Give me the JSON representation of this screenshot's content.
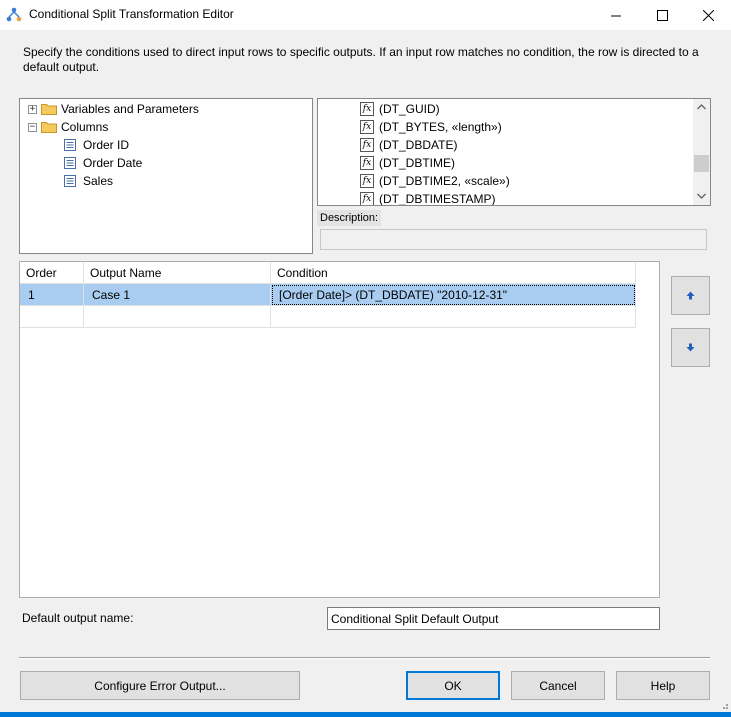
{
  "window": {
    "title": "Conditional Split Transformation Editor",
    "minimize_glyph": "—",
    "maximize_glyph": "☐",
    "close_glyph": "✕"
  },
  "instructions": "Specify the conditions used to direct input rows to specific outputs. If an input row matches no condition, the row is directed to a default output.",
  "tree": {
    "variables_label": "Variables and Parameters",
    "variables_expander": "+",
    "columns_label": "Columns",
    "columns_expander": "−",
    "columns": [
      "Order ID",
      "Order Date",
      "Sales"
    ]
  },
  "functions": {
    "icon_text": "fx",
    "items": [
      "(DT_GUID)",
      "(DT_BYTES, «length»)",
      "(DT_DBDATE)",
      "(DT_DBTIME)",
      "(DT_DBTIME2, «scale»)",
      "(DT_DBTIMESTAMP)"
    ]
  },
  "description": {
    "label": "Description:",
    "value": ""
  },
  "grid": {
    "headers": {
      "order": "Order",
      "output_name": "Output Name",
      "condition": "Condition"
    },
    "rows": [
      {
        "order": "1",
        "output_name": "Case 1",
        "condition": "[Order Date]> (DT_DBDATE) \"2010-12-31\""
      }
    ]
  },
  "default_output": {
    "label": "Default output name:",
    "value": "Conditional Split Default Output"
  },
  "buttons": {
    "configure_error": "Configure Error Output...",
    "ok": "OK",
    "cancel": "Cancel",
    "help": "Help"
  },
  "colors": {
    "selection": "#a8cdf0",
    "accent": "#0078d7",
    "arrow": "#1f5fbf"
  }
}
